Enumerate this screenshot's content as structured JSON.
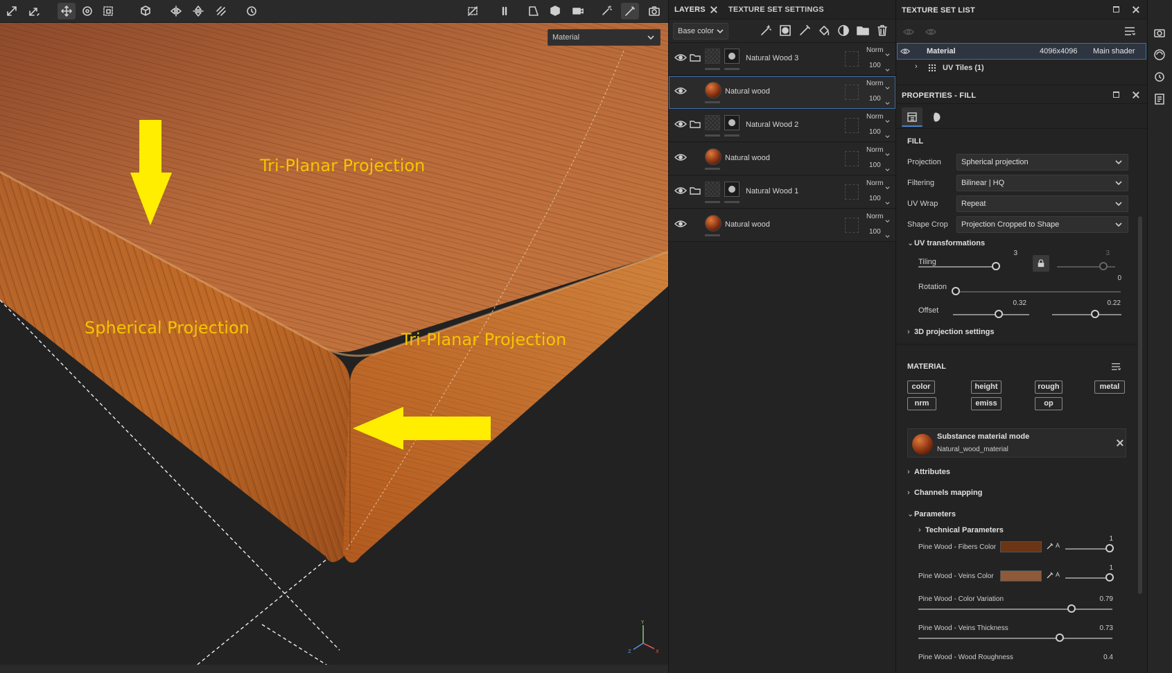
{
  "viewport": {
    "material_select": "Material",
    "annotations": {
      "top": "Tri-Planar Projection",
      "left": "Spherical Projection",
      "right": "Tri-Planar Projection"
    },
    "annotation_color": "#f5c400"
  },
  "layers_panel": {
    "tabs": [
      "LAYERS",
      "TEXTURE SET SETTINGS"
    ],
    "channel_select": "Base color",
    "layers": [
      {
        "name": "Natural Wood 3",
        "type": "folder-mask",
        "blend": "Norm",
        "opacity": "100"
      },
      {
        "name": "Natural wood",
        "type": "fill",
        "blend": "Norm",
        "opacity": "100",
        "selected": true
      },
      {
        "name": "Natural Wood 2",
        "type": "folder-mask",
        "blend": "Norm",
        "opacity": "100"
      },
      {
        "name": "Natural wood",
        "type": "fill",
        "blend": "Norm",
        "opacity": "100"
      },
      {
        "name": "Natural Wood 1",
        "type": "folder-mask",
        "blend": "Norm",
        "opacity": "100"
      },
      {
        "name": "Natural wood",
        "type": "fill",
        "blend": "Norm",
        "opacity": "100"
      }
    ]
  },
  "texture_set_list": {
    "title": "TEXTURE SET LIST",
    "row": {
      "name": "Material",
      "resolution": "4096x4096",
      "shader": "Main shader"
    },
    "uv_tiles": "UV Tiles (1)"
  },
  "properties": {
    "title": "PROPERTIES - FILL",
    "fill": {
      "title": "FILL",
      "projection_label": "Projection",
      "projection": "Spherical projection",
      "filtering_label": "Filtering",
      "filtering": "Bilinear | HQ",
      "uvwrap_label": "UV Wrap",
      "uvwrap": "Repeat",
      "shapecrop_label": "Shape Crop",
      "shapecrop": "Projection Cropped to Shape"
    },
    "uv_transformations": {
      "title": "UV transformations",
      "tiling_label": "Tiling",
      "tiling_u": "3",
      "tiling_v": "3",
      "rotation_label": "Rotation",
      "rotation": "0",
      "offset_label": "Offset",
      "offset_u": "0.32",
      "offset_v": "0.22"
    },
    "projection_3d": "3D projection settings",
    "material": {
      "title": "MATERIAL",
      "chips": [
        "color",
        "height",
        "rough",
        "metal",
        "nrm",
        "emiss",
        "op"
      ],
      "mode_title": "Substance material mode",
      "mode_sub": "Natural_wood_material",
      "attributes": "Attributes",
      "channels_mapping": "Channels mapping",
      "parameters": "Parameters",
      "technical_parameters": "Technical Parameters",
      "params": [
        {
          "label": "Pine Wood - Fibers Color",
          "value": "1",
          "color": "#6b3414",
          "alpha": "A"
        },
        {
          "label": "Pine Wood - Veins Color",
          "value": "1",
          "color": "#8e5a3a",
          "alpha": "A"
        },
        {
          "label": "Pine Wood - Color Variation",
          "value": "0.79"
        },
        {
          "label": "Pine Wood - Veins Thickness",
          "value": "0.73"
        },
        {
          "label": "Pine Wood - Wood Roughness",
          "value": "0.4"
        }
      ]
    }
  }
}
